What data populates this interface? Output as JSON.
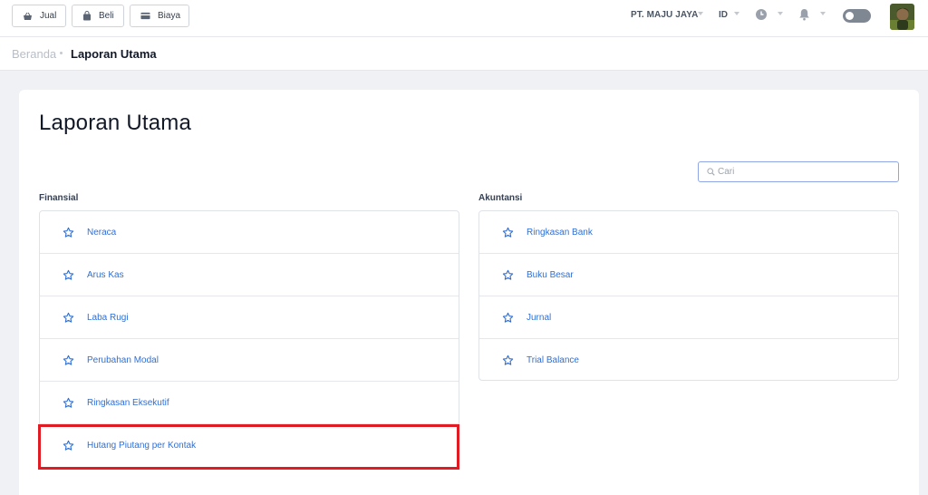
{
  "topbar": {
    "buttons": [
      {
        "label": "Jual",
        "icon": "basket-icon"
      },
      {
        "label": "Beli",
        "icon": "shopping-bag-icon"
      },
      {
        "label": "Biaya",
        "icon": "credit-card-icon"
      }
    ],
    "company": "PT. MAJU JAYA",
    "language": "ID",
    "icons": [
      "clock-icon",
      "bell-icon",
      "toggle-switch",
      "avatar"
    ]
  },
  "breadcrumb": {
    "home": "Beranda",
    "current": "Laporan Utama"
  },
  "page": {
    "title": "Laporan Utama",
    "search_placeholder": "Cari"
  },
  "sections": {
    "finansial": {
      "label": "Finansial",
      "items": [
        {
          "label": "Neraca"
        },
        {
          "label": "Arus Kas"
        },
        {
          "label": "Laba Rugi"
        },
        {
          "label": "Perubahan Modal"
        },
        {
          "label": "Ringkasan Eksekutif"
        },
        {
          "label": "Hutang Piutang per Kontak"
        }
      ]
    },
    "akuntansi": {
      "label": "Akuntansi",
      "items": [
        {
          "label": "Ringkasan Bank"
        },
        {
          "label": "Buku Besar"
        },
        {
          "label": "Jurnal"
        },
        {
          "label": "Trial Balance"
        }
      ]
    }
  },
  "colors": {
    "link": "#2f6fd6",
    "star": "#2f6fd6",
    "highlight": "#e01b24",
    "search_border": "#8fa5e5"
  }
}
